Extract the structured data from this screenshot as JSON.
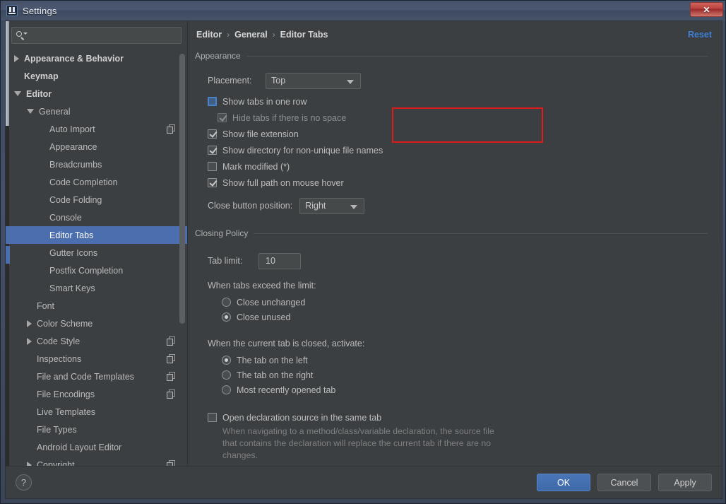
{
  "window": {
    "title": "Settings",
    "app_icon": "intellij-idea-icon",
    "close_label": "✕"
  },
  "sidebar": {
    "search": {
      "placeholder": "",
      "value": "",
      "icon": "search-icon"
    },
    "items": [
      {
        "label": "Appearance & Behavior",
        "indent": 0,
        "arrow": "collapsed",
        "bold": true,
        "selected": false,
        "copy": false
      },
      {
        "label": "Keymap",
        "indent": 0,
        "arrow": "none",
        "bold": true,
        "selected": false,
        "copy": false
      },
      {
        "label": "Editor",
        "indent": 0,
        "arrow": "expanded",
        "bold": true,
        "selected": false,
        "copy": false
      },
      {
        "label": "General",
        "indent": 1,
        "arrow": "expanded",
        "bold": false,
        "selected": false,
        "copy": false
      },
      {
        "label": "Auto Import",
        "indent": 2,
        "arrow": "none",
        "bold": false,
        "selected": false,
        "copy": true
      },
      {
        "label": "Appearance",
        "indent": 2,
        "arrow": "none",
        "bold": false,
        "selected": false,
        "copy": false
      },
      {
        "label": "Breadcrumbs",
        "indent": 2,
        "arrow": "none",
        "bold": false,
        "selected": false,
        "copy": false
      },
      {
        "label": "Code Completion",
        "indent": 2,
        "arrow": "none",
        "bold": false,
        "selected": false,
        "copy": false
      },
      {
        "label": "Code Folding",
        "indent": 2,
        "arrow": "none",
        "bold": false,
        "selected": false,
        "copy": false
      },
      {
        "label": "Console",
        "indent": 2,
        "arrow": "none",
        "bold": false,
        "selected": false,
        "copy": false
      },
      {
        "label": "Editor Tabs",
        "indent": 2,
        "arrow": "none",
        "bold": false,
        "selected": true,
        "copy": false
      },
      {
        "label": "Gutter Icons",
        "indent": 2,
        "arrow": "none",
        "bold": false,
        "selected": false,
        "copy": false
      },
      {
        "label": "Postfix Completion",
        "indent": 2,
        "arrow": "none",
        "bold": false,
        "selected": false,
        "copy": false
      },
      {
        "label": "Smart Keys",
        "indent": 2,
        "arrow": "none",
        "bold": false,
        "selected": false,
        "copy": false
      },
      {
        "label": "Font",
        "indent": 1,
        "arrow": "none",
        "bold": false,
        "selected": false,
        "copy": false
      },
      {
        "label": "Color Scheme",
        "indent": 1,
        "arrow": "collapsed",
        "bold": false,
        "selected": false,
        "copy": false
      },
      {
        "label": "Code Style",
        "indent": 1,
        "arrow": "collapsed",
        "bold": false,
        "selected": false,
        "copy": true
      },
      {
        "label": "Inspections",
        "indent": 1,
        "arrow": "none",
        "bold": false,
        "selected": false,
        "copy": true
      },
      {
        "label": "File and Code Templates",
        "indent": 1,
        "arrow": "none",
        "bold": false,
        "selected": false,
        "copy": true
      },
      {
        "label": "File Encodings",
        "indent": 1,
        "arrow": "none",
        "bold": false,
        "selected": false,
        "copy": true
      },
      {
        "label": "Live Templates",
        "indent": 1,
        "arrow": "none",
        "bold": false,
        "selected": false,
        "copy": false
      },
      {
        "label": "File Types",
        "indent": 1,
        "arrow": "none",
        "bold": false,
        "selected": false,
        "copy": false
      },
      {
        "label": "Android Layout Editor",
        "indent": 1,
        "arrow": "none",
        "bold": false,
        "selected": false,
        "copy": false
      },
      {
        "label": "Copyright",
        "indent": 1,
        "arrow": "collapsed",
        "bold": false,
        "selected": false,
        "copy": true
      }
    ]
  },
  "main": {
    "breadcrumb": {
      "items": [
        "Editor",
        "General",
        "Editor Tabs"
      ],
      "separator": "›"
    },
    "reset_label": "Reset",
    "appearance": {
      "group_title": "Appearance",
      "placement_label": "Placement:",
      "placement_value": "Top",
      "checkboxes": [
        {
          "label": "Show tabs in one row",
          "checked": false,
          "focused": true,
          "disabled": false,
          "indent": 0
        },
        {
          "label": "Hide tabs if there is no space",
          "checked": true,
          "focused": false,
          "disabled": true,
          "indent": 1
        },
        {
          "label": "Show file extension",
          "checked": true,
          "focused": false,
          "disabled": false,
          "indent": 0
        },
        {
          "label": "Show directory for non-unique file names",
          "checked": true,
          "focused": false,
          "disabled": false,
          "indent": 0
        },
        {
          "label": "Mark modified (*)",
          "checked": false,
          "focused": false,
          "disabled": false,
          "indent": 0
        },
        {
          "label": "Show full path on mouse hover",
          "checked": true,
          "focused": false,
          "disabled": false,
          "indent": 0
        }
      ],
      "close_button_label": "Close button position:",
      "close_button_value": "Right"
    },
    "closing_policy": {
      "group_title": "Closing Policy",
      "tab_limit_label": "Tab limit:",
      "tab_limit_value": "10",
      "exceed_label": "When tabs exceed the limit:",
      "exceed_options": [
        {
          "label": "Close unchanged",
          "selected": false
        },
        {
          "label": "Close unused",
          "selected": true
        }
      ],
      "activate_label": "When the current tab is closed, activate:",
      "activate_options": [
        {
          "label": "The tab on the left",
          "selected": true
        },
        {
          "label": "The tab on the right",
          "selected": false
        },
        {
          "label": "Most recently opened tab",
          "selected": false
        }
      ],
      "open_declaration": {
        "label": "Open declaration source in the same tab",
        "checked": false
      },
      "open_declaration_hint": "When navigating to a method/class/variable declaration, the source file that contains the declaration will replace the current tab if there are no changes."
    }
  },
  "footer": {
    "help_label": "?",
    "ok_label": "OK",
    "cancel_label": "Cancel",
    "apply_label": "Apply"
  },
  "colors": {
    "accent": "#4b6eaf",
    "link": "#3f7fd4",
    "annotation": "#e01b1b",
    "panel_bg": "#3c3f41",
    "field_bg": "#45494a"
  }
}
